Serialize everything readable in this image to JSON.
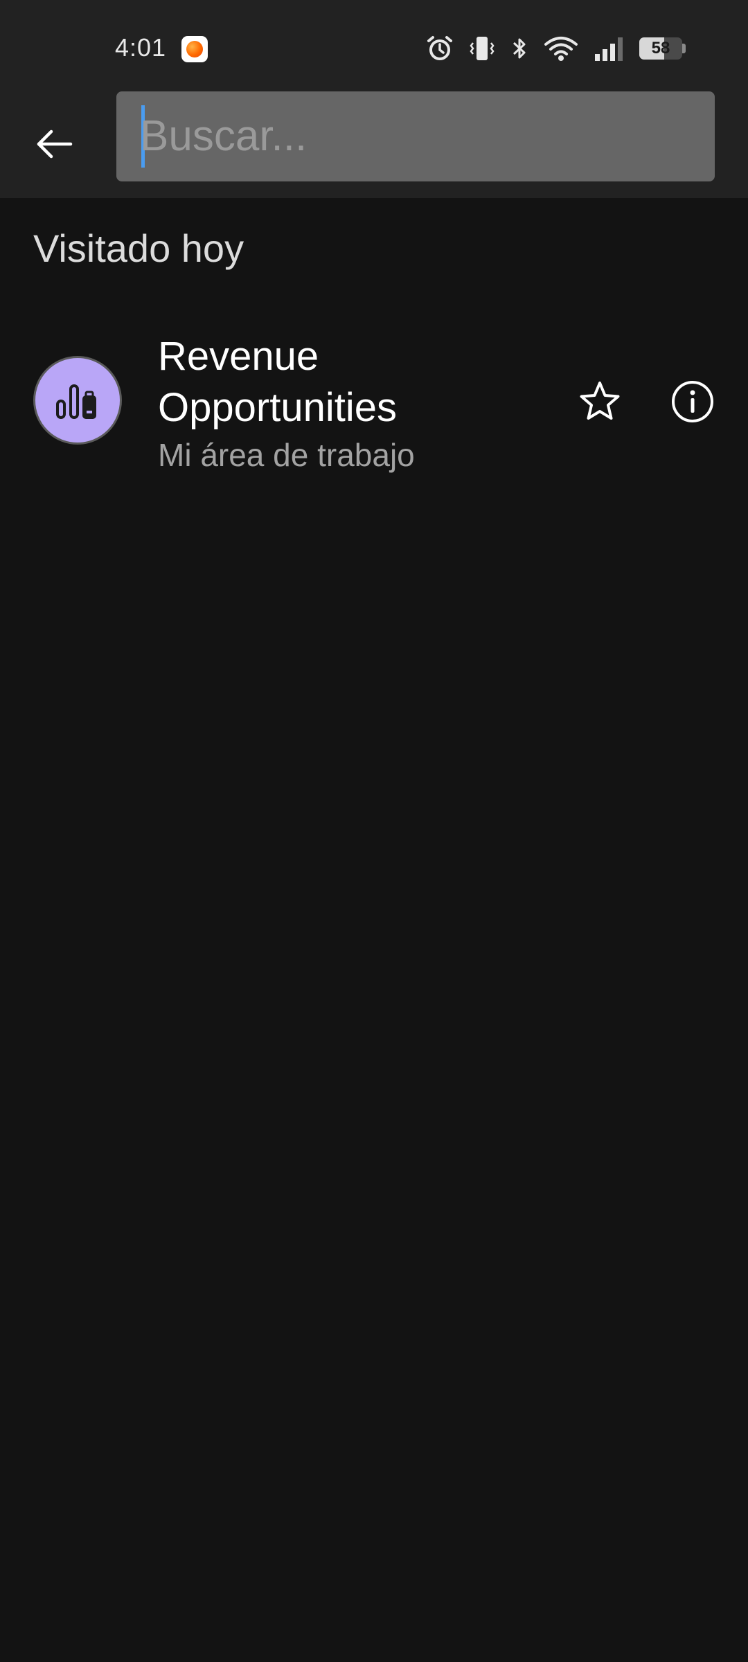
{
  "status_bar": {
    "time": "4:01",
    "notification_app_icon": "orange-app-icon",
    "icons": [
      "alarm-icon",
      "vibrate-icon",
      "bluetooth-icon",
      "wifi-icon",
      "signal-icon"
    ],
    "battery_percent": "58",
    "battery_level": 0.58
  },
  "app_bar": {
    "back_icon": "arrow-left-icon",
    "search": {
      "placeholder": "Buscar...",
      "value": ""
    }
  },
  "section": {
    "title": "Visitado hoy"
  },
  "items": [
    {
      "title": "Revenue Opportunities",
      "subtitle": "Mi área de trabajo",
      "icon": "report-chart-icon",
      "avatar_color": "#b9a6f7",
      "star_icon": "star-outline-icon",
      "info_icon": "info-icon"
    }
  ],
  "colors": {
    "background": "#131313",
    "bars": "#222222",
    "search_field": "#666666",
    "caret": "#4a9cf0"
  }
}
